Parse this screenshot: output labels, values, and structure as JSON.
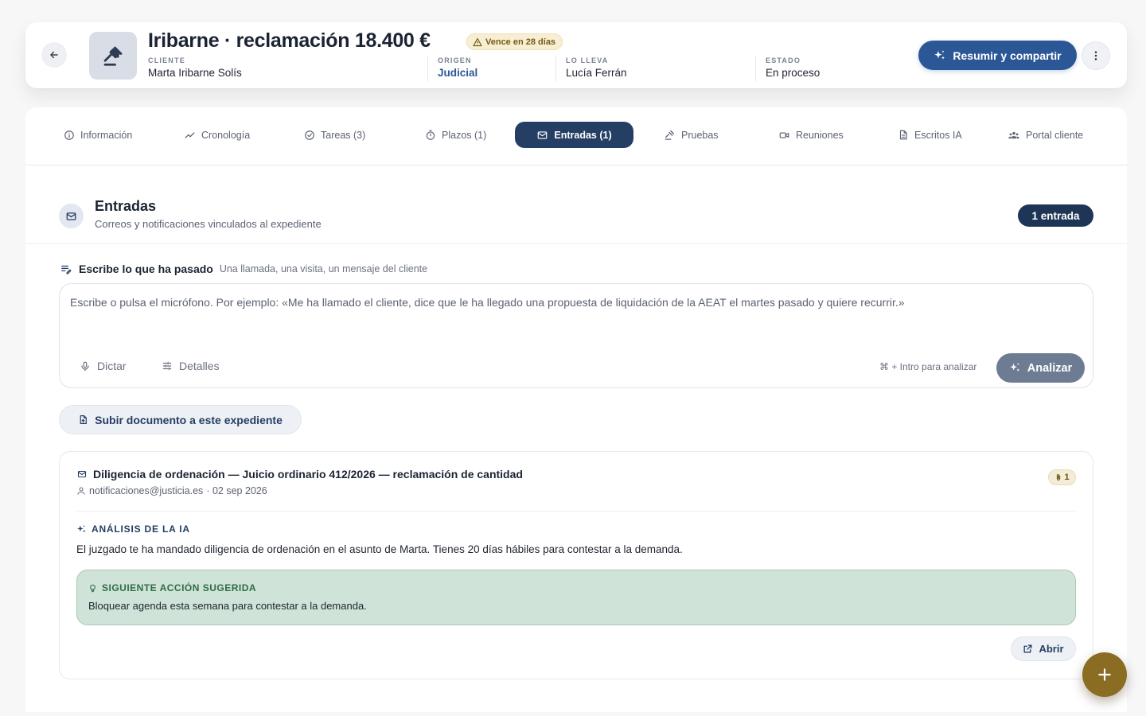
{
  "header": {
    "title": "Iribarne · reclamación 18.400 €",
    "due_badge": "Vence en 28 días",
    "meta": [
      {
        "label": "CLIENTE",
        "value": "Marta Iribarne Solís"
      },
      {
        "label": "ORIGEN",
        "value": "Judicial"
      },
      {
        "label": "LO LLEVA",
        "value": "Lucía Ferrán"
      },
      {
        "label": "ESTADO",
        "value": "En proceso"
      }
    ],
    "share_label": "Resumir y compartir"
  },
  "tabs": [
    {
      "label": "Información",
      "icon": "info-icon"
    },
    {
      "label": "Cronología",
      "icon": "trend-icon"
    },
    {
      "label": "Tareas (3)",
      "icon": "check-circle-icon"
    },
    {
      "label": "Plazos (1)",
      "icon": "stopwatch-icon"
    },
    {
      "label": "Entradas (1)",
      "icon": "mail-icon",
      "active": true
    },
    {
      "label": "Pruebas",
      "icon": "gavel-icon"
    },
    {
      "label": "Reuniones",
      "icon": "video-icon"
    },
    {
      "label": "Escritos IA",
      "icon": "document-icon"
    },
    {
      "label": "Portal cliente",
      "icon": "group-icon"
    }
  ],
  "section": {
    "title": "Entradas",
    "subtitle": "Correos y notificaciones vinculados al expediente",
    "count_label": "1 entrada"
  },
  "composer": {
    "label": "Escribe lo que ha pasado",
    "hint": "Una llamada, una visita, un mensaje del cliente",
    "placeholder": "Escribe o pulsa el micrófono. Por ejemplo: «Me ha llamado el cliente, dice que le ha llegado una propuesta de liquidación de la AEAT el martes pasado y quiere recurrir.»",
    "dictate_label": "Dictar",
    "details_label": "Detalles",
    "shortcut_hint": "⌘ + Intro para analizar",
    "analyze_label": "Analizar"
  },
  "upload_label": "Subir documento a este expediente",
  "entry": {
    "title": "Diligencia de ordenación — Juicio ordinario 412/2026 — reclamación de cantidad",
    "sender": "notificaciones@justicia.es",
    "date": "· 02 sep 2026",
    "attachments": "1",
    "ai_label": "ANÁLISIS DE LA IA",
    "ai_text": "El juzgado te ha mandado diligencia de ordenación en el asunto de Marta. Tienes 20 días hábiles para contestar a la demanda.",
    "next_label": "SIGUIENTE ACCIÓN SUGERIDA",
    "next_text": "Bloquear agenda esta semana para contestar a la demanda.",
    "open_label": "Abrir"
  },
  "colors": {
    "primary": "#2c5797",
    "navy": "#253e63",
    "gold": "#8a6d22",
    "success_bg": "#cfe3d8"
  }
}
